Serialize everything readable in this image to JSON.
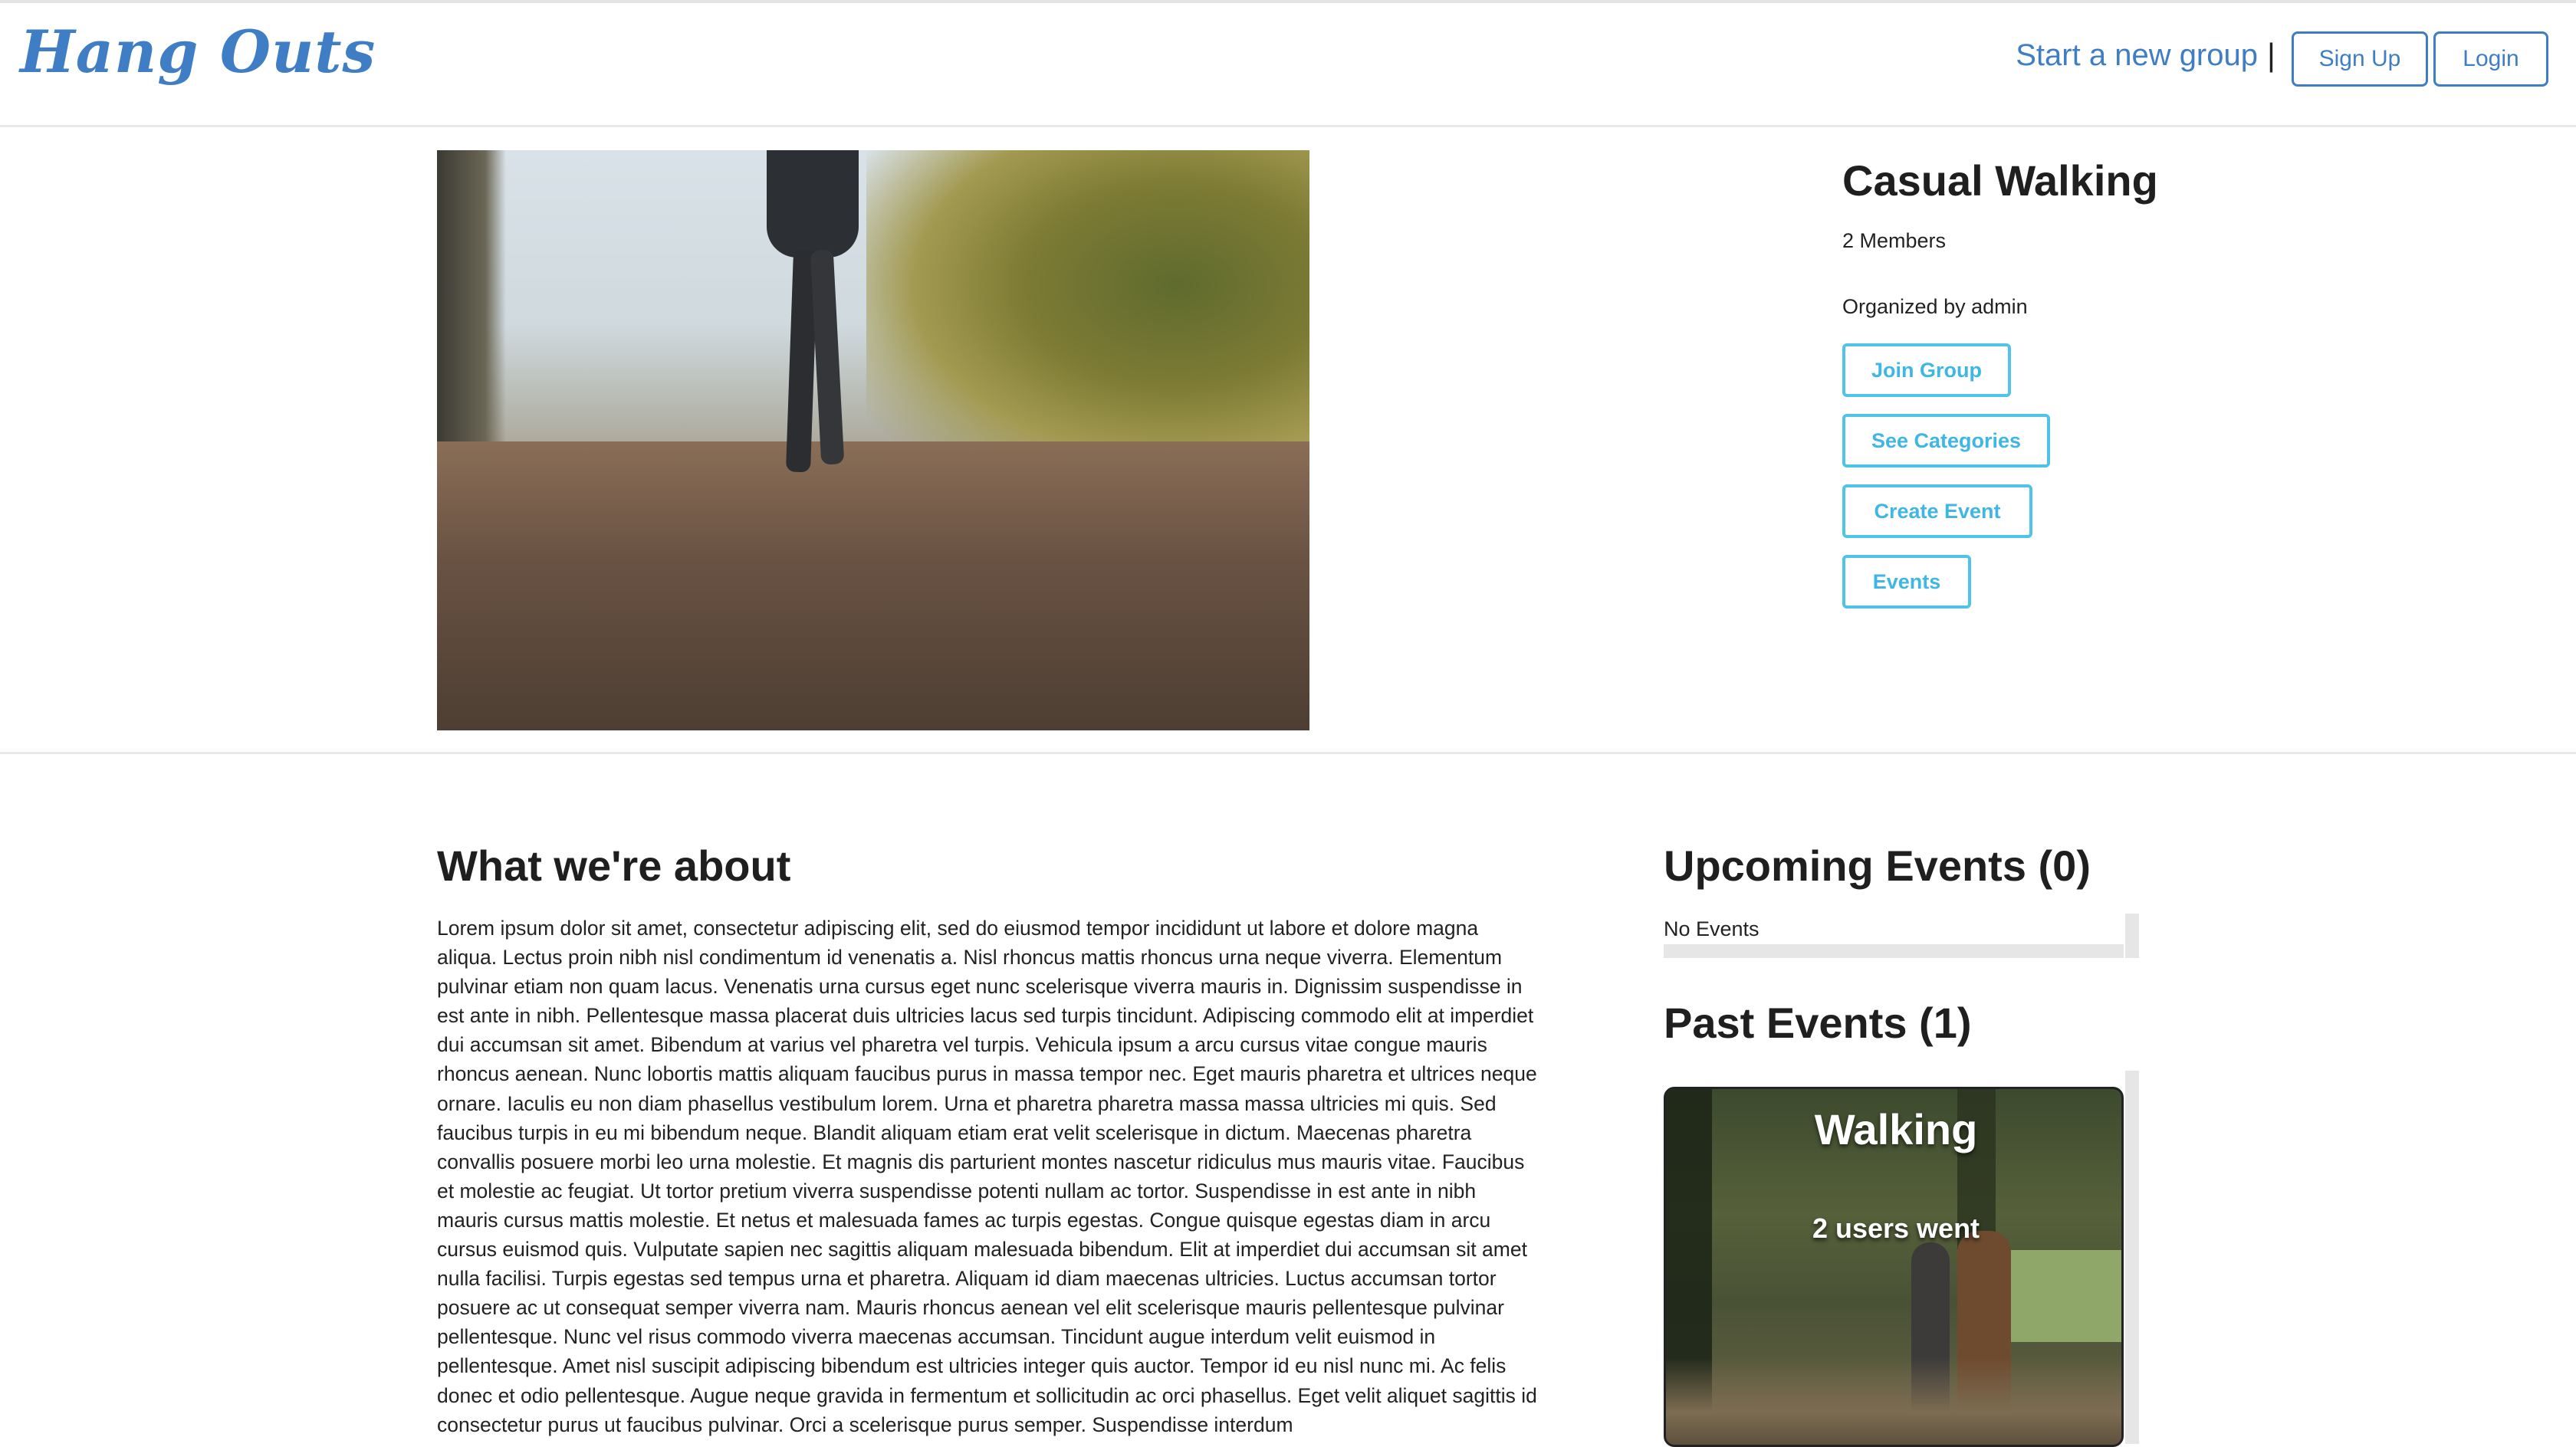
{
  "header": {
    "logo": "Hang Outs",
    "start_group_link": "Start a new group",
    "separator": "|",
    "signup_label": "Sign Up",
    "login_label": "Login"
  },
  "group": {
    "title": "Casual Walking",
    "members": "2 Members",
    "organizer": "Organized by admin",
    "buttons": {
      "join": "Join Group",
      "categories": "See Categories",
      "create_event": "Create Event",
      "events": "Events"
    }
  },
  "about": {
    "title": "What we're about",
    "text": "Lorem ipsum dolor sit amet, consectetur adipiscing elit, sed do eiusmod tempor incididunt ut labore et dolore magna aliqua. Lectus proin nibh nisl condimentum id venenatis a. Nisl rhoncus mattis rhoncus urna neque viverra. Elementum pulvinar etiam non quam lacus. Venenatis urna cursus eget nunc scelerisque viverra mauris in. Dignissim suspendisse in est ante in nibh. Pellentesque massa placerat duis ultricies lacus sed turpis tincidunt. Adipiscing commodo elit at imperdiet dui accumsan sit amet. Bibendum at varius vel pharetra vel turpis. Vehicula ipsum a arcu cursus vitae congue mauris rhoncus aenean. Nunc lobortis mattis aliquam faucibus purus in massa tempor nec. Eget mauris pharetra et ultrices neque ornare. Iaculis eu non diam phasellus vestibulum lorem. Urna et pharetra pharetra massa massa ultricies mi quis. Sed faucibus turpis in eu mi bibendum neque. Blandit aliquam etiam erat velit scelerisque in dictum. Maecenas pharetra convallis posuere morbi leo urna molestie.  Et magnis dis parturient montes nascetur ridiculus mus mauris vitae. Faucibus et molestie ac feugiat. Ut tortor pretium viverra suspendisse potenti nullam ac tortor. Suspendisse in est ante in nibh mauris cursus mattis molestie. Et netus et malesuada fames ac turpis egestas. Congue quisque egestas diam in arcu cursus euismod quis. Vulputate sapien nec sagittis aliquam malesuada bibendum. Elit at imperdiet dui accumsan sit amet nulla facilisi. Turpis egestas sed tempus urna et pharetra. Aliquam id diam maecenas ultricies. Luctus accumsan tortor posuere ac ut consequat semper viverra nam. Mauris rhoncus aenean vel elit scelerisque mauris pellentesque pulvinar pellentesque. Nunc vel risus commodo viverra maecenas accumsan. Tincidunt augue interdum velit euismod in pellentesque. Amet nisl suscipit adipiscing bibendum est ultricies integer quis auctor.  Tempor id eu nisl nunc mi. Ac felis donec et odio pellentesque. Augue neque gravida in fermentum et sollicitudin ac orci phasellus. Eget velit aliquet sagittis id consectetur purus ut faucibus pulvinar. Orci a scelerisque purus semper. Suspendisse interdum"
  },
  "upcoming": {
    "title": "Upcoming Events (0)",
    "empty": "No Events"
  },
  "past": {
    "title": "Past Events (1)",
    "events": [
      {
        "name": "Walking",
        "attendance": "2 users went"
      }
    ]
  },
  "colors": {
    "brand_blue": "#3f7dc4",
    "button_cyan": "#4fc3e8"
  }
}
